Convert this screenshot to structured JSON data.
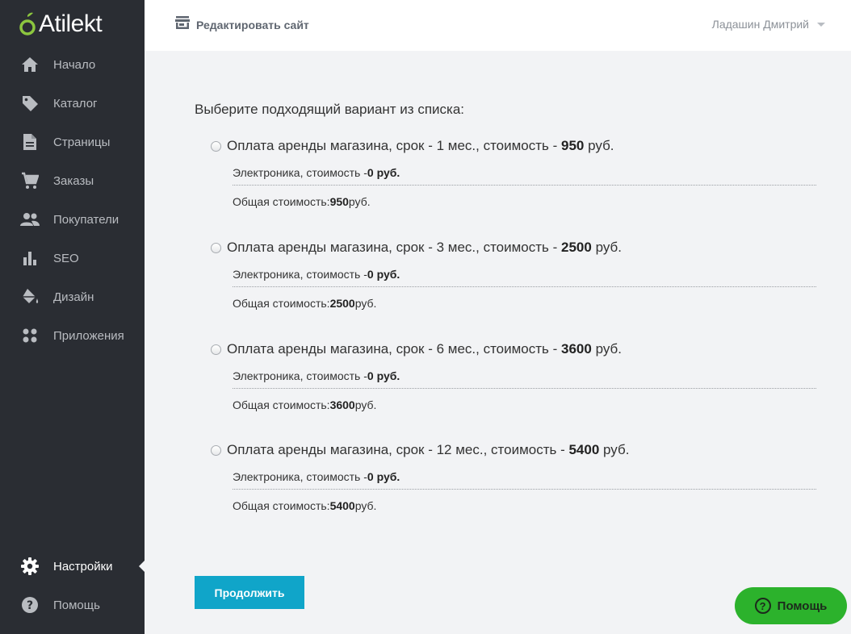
{
  "brand": {
    "name": "Atilekt"
  },
  "sidebar": {
    "items": [
      {
        "label": "Начало",
        "icon": "home-icon"
      },
      {
        "label": "Каталог",
        "icon": "tag-icon"
      },
      {
        "label": "Страницы",
        "icon": "document-icon"
      },
      {
        "label": "Заказы",
        "icon": "cart-icon"
      },
      {
        "label": "Покупатели",
        "icon": "people-icon"
      },
      {
        "label": "SEO",
        "icon": "bar-chart-icon"
      },
      {
        "label": "Дизайн",
        "icon": "paint-bucket-icon"
      },
      {
        "label": "Приложения",
        "icon": "apps-grid-icon"
      }
    ],
    "bottom_items": [
      {
        "label": "Настройки",
        "icon": "gear-icon",
        "active": true
      },
      {
        "label": "Помощь",
        "icon": "help-circle-icon"
      }
    ]
  },
  "topbar": {
    "edit_site_label": "Редактировать сайт",
    "user_name": "Ладашин Дмитрий"
  },
  "main": {
    "prompt": "Выберите подходящий вариант из списка:",
    "options": [
      {
        "prefix": "Оплата аренды магазина, срок - 1 мес., стоимость - ",
        "price": "950",
        "suffix": " руб.",
        "detail_label": "Электроника, стоимость - ",
        "detail_value": "0 руб.",
        "total_label": "Общая стоимость: ",
        "total_value": "950",
        "total_suffix": " руб."
      },
      {
        "prefix": "Оплата аренды магазина, срок - 3 мес., стоимость - ",
        "price": "2500",
        "suffix": " руб.",
        "detail_label": "Электроника, стоимость - ",
        "detail_value": "0 руб.",
        "total_label": "Общая стоимость: ",
        "total_value": "2500",
        "total_suffix": " руб."
      },
      {
        "prefix": "Оплата аренды магазина, срок - 6 мес., стоимость - ",
        "price": "3600",
        "suffix": " руб.",
        "detail_label": "Электроника, стоимость - ",
        "detail_value": "0 руб.",
        "total_label": "Общая стоимость: ",
        "total_value": "3600",
        "total_suffix": " руб."
      },
      {
        "prefix": "Оплата аренды магазина, срок - 12 мес., стоимость - ",
        "price": "5400",
        "suffix": " руб.",
        "detail_label": "Электроника, стоимость - ",
        "detail_value": "0 руб.",
        "total_label": "Общая стоимость: ",
        "total_value": "5400",
        "total_suffix": " руб."
      }
    ],
    "continue_label": "Продолжить"
  },
  "help_button": {
    "label": "Помощь",
    "glyph": "?"
  },
  "colors": {
    "sidebar_bg": "#2a2d33",
    "accent": "#10a5c9",
    "help_green": "#2cb22c",
    "brand_green": "#8cc63f"
  }
}
